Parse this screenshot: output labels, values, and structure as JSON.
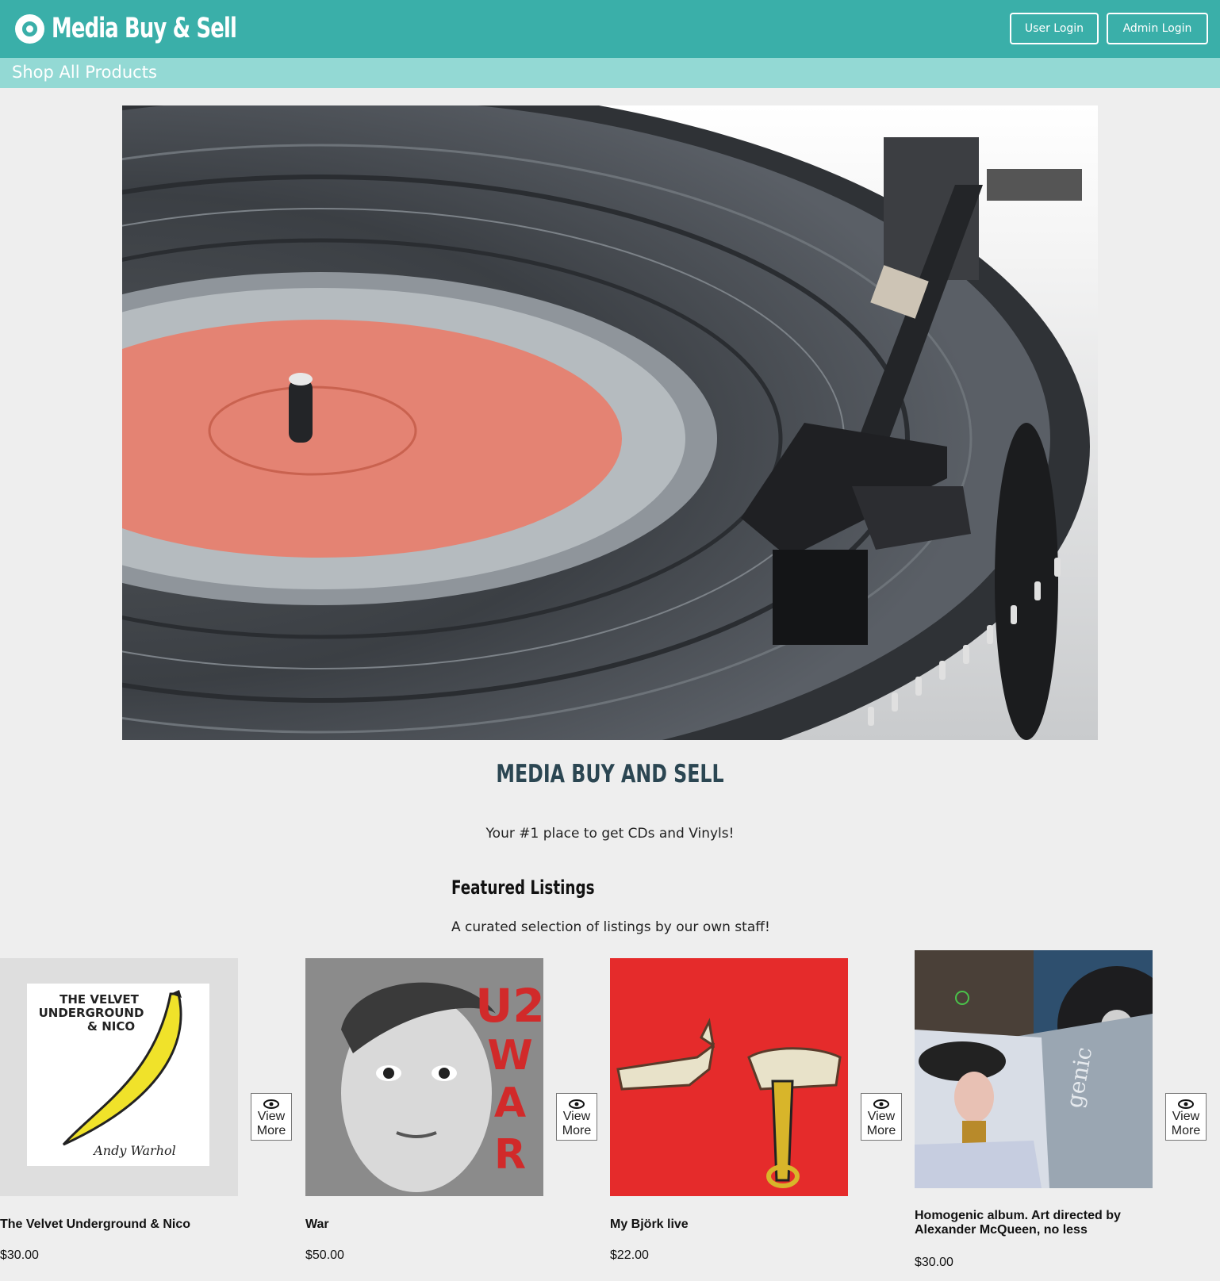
{
  "header": {
    "brand": "Media Buy & Sell",
    "user_login": "User Login",
    "admin_login": "Admin Login"
  },
  "nav": {
    "shop_all": "Shop All Products"
  },
  "hero": {
    "image": "vinyl-turntable-photo"
  },
  "intro": {
    "title": "MEDIA BUY AND SELL",
    "tagline": "Your #1 place to get CDs and Vinyls!"
  },
  "featured": {
    "title": "Featured Listings",
    "subtitle": "A curated selection of listings by our own staff!",
    "view_more_label": "View More",
    "items": [
      {
        "name": "The Velvet Underground & Nico",
        "price": "$30.00",
        "cover": "velvet-underground-banana-cover"
      },
      {
        "name": "War",
        "price": "$50.00",
        "cover": "u2-war-cover"
      },
      {
        "name": "My Björk live",
        "price": "$22.00",
        "cover": "run-the-jewels-cover"
      },
      {
        "name": "Homogenic album. Art directed by Alexander McQueen, no less",
        "price": "$30.00",
        "cover": "homogenic-photo"
      }
    ]
  },
  "colors": {
    "header": "#3aafa9",
    "subnav": "#93d9d4",
    "title": "#2b4652",
    "background": "#eeeeee"
  }
}
